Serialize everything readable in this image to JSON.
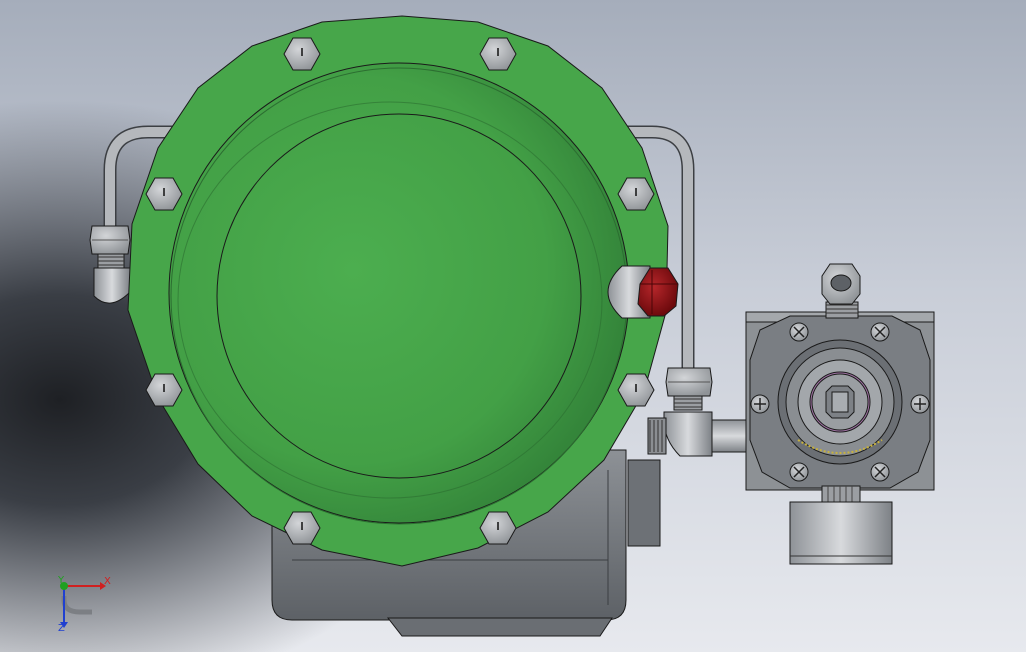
{
  "viewport": {
    "background": "gradient-gray",
    "model_color": "#47a64a",
    "plug_color": "#8b0f12"
  },
  "triad": {
    "x_label": "X",
    "y_label": "Y",
    "z_label": "Z",
    "x_color": "#d02020",
    "y_color": "#20a020",
    "z_color": "#2040d0"
  }
}
